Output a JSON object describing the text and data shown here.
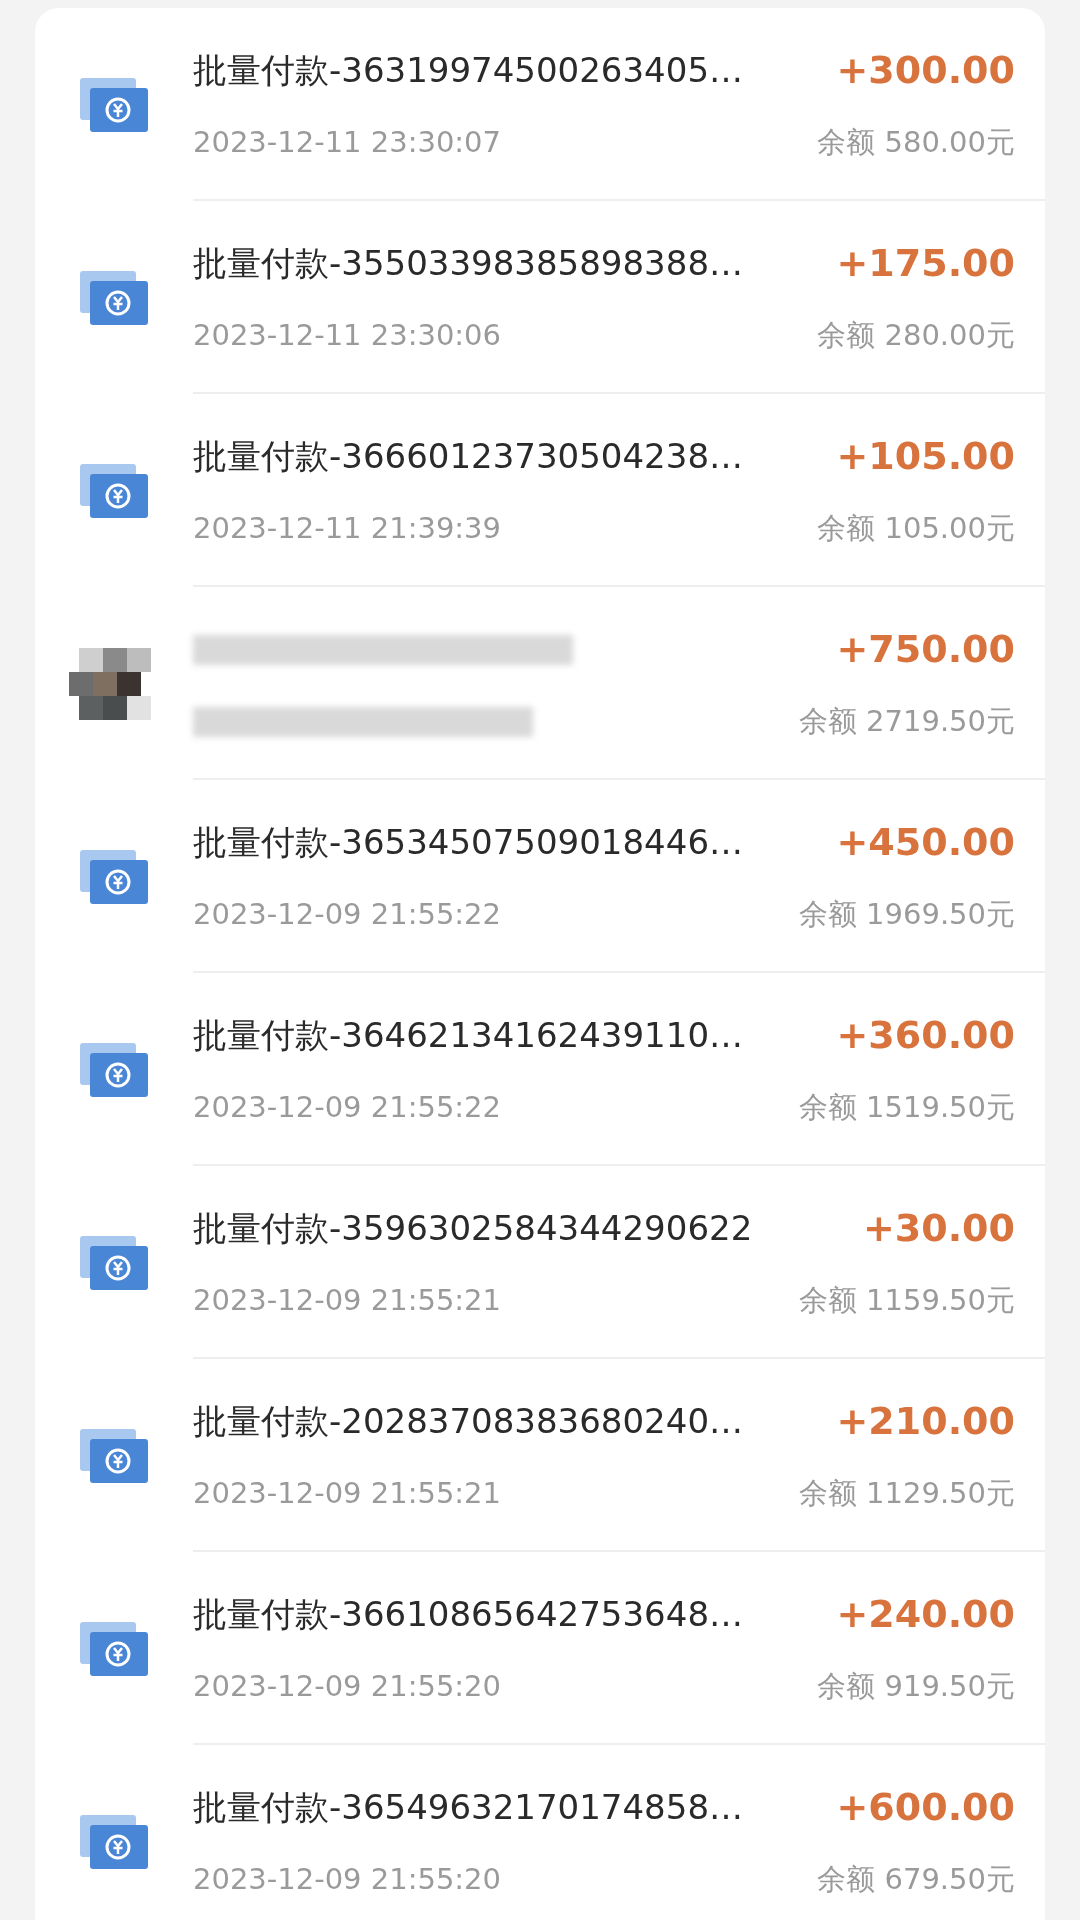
{
  "transactions": [
    {
      "kind": "batch",
      "title": "批量付款-36319974500263405…",
      "time": "2023-12-11 23:30:07",
      "amount": "+300.00",
      "balance": "余额 580.00元"
    },
    {
      "kind": "batch",
      "title": "批量付款-35503398385898388…",
      "time": "2023-12-11 23:30:06",
      "amount": "+175.00",
      "balance": "余额 280.00元"
    },
    {
      "kind": "batch",
      "title": "批量付款-36660123730504238…",
      "time": "2023-12-11 21:39:39",
      "amount": "+105.00",
      "balance": "余额 105.00元"
    },
    {
      "kind": "redacted",
      "amount": "+750.00",
      "balance": "余额 2719.50元"
    },
    {
      "kind": "batch",
      "title": "批量付款-36534507509018446…",
      "time": "2023-12-09 21:55:22",
      "amount": "+450.00",
      "balance": "余额 1969.50元"
    },
    {
      "kind": "batch",
      "title": "批量付款-36462134162439110…",
      "time": "2023-12-09 21:55:22",
      "amount": "+360.00",
      "balance": "余额 1519.50元"
    },
    {
      "kind": "batch",
      "title": "批量付款-3596302584344290622",
      "time": "2023-12-09 21:55:21",
      "amount": "+30.00",
      "balance": "余额 1159.50元"
    },
    {
      "kind": "batch",
      "title": "批量付款-20283708383680240…",
      "time": "2023-12-09 21:55:21",
      "amount": "+210.00",
      "balance": "余额 1129.50元"
    },
    {
      "kind": "batch",
      "title": "批量付款-36610865642753648…",
      "time": "2023-12-09 21:55:20",
      "amount": "+240.00",
      "balance": "余额 919.50元"
    },
    {
      "kind": "batch",
      "title": "批量付款-36549632170174858…",
      "time": "2023-12-09 21:55:20",
      "amount": "+600.00",
      "balance": "余额 679.50元"
    }
  ]
}
